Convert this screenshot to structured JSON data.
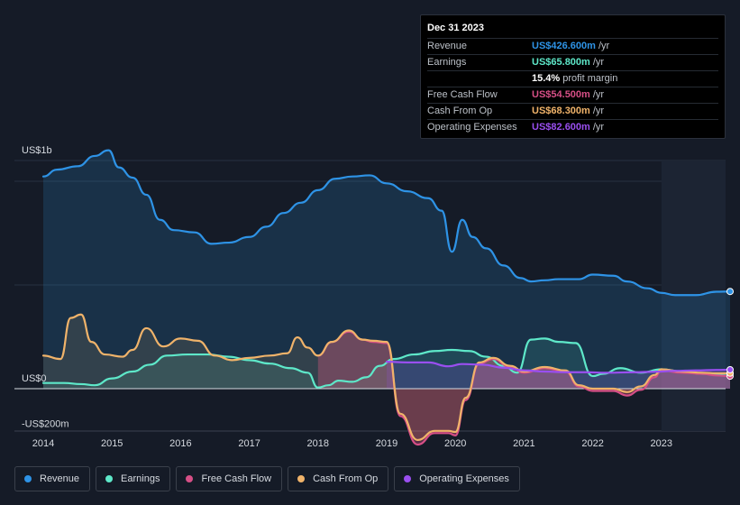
{
  "tooltip": {
    "date": "Dec 31 2023",
    "rows": [
      {
        "label": "Revenue",
        "value": "US$426.600m",
        "unit": "/yr",
        "color": "#2e93e6"
      },
      {
        "label": "Earnings",
        "value": "US$65.800m",
        "unit": "/yr",
        "color": "#5ee8c9"
      },
      {
        "label": "",
        "value": "15.4%",
        "unit": "profit margin",
        "color": "#ffffff"
      },
      {
        "label": "Free Cash Flow",
        "value": "US$54.500m",
        "unit": "/yr",
        "color": "#d64f86"
      },
      {
        "label": "Cash From Op",
        "value": "US$68.300m",
        "unit": "/yr",
        "color": "#f0b36a"
      },
      {
        "label": "Operating Expenses",
        "value": "US$82.600m",
        "unit": "/yr",
        "color": "#9a4ff0"
      }
    ]
  },
  "chart_data": {
    "type": "area",
    "y_tick_labels": [
      "US$1b",
      "US$0",
      "-US$200m"
    ],
    "ylim": [
      -200,
      1000
    ],
    "xlim": [
      2013.6,
      2024.0
    ],
    "x_tick_labels": [
      "2014",
      "2015",
      "2016",
      "2017",
      "2018",
      "2019",
      "2020",
      "2021",
      "2022",
      "2023"
    ],
    "x_ticks": [
      2014,
      2015,
      2016,
      2017,
      2018,
      2019,
      2020,
      2021,
      2022,
      2023
    ],
    "highlight_from": 2023.0,
    "grid": true,
    "series": [
      {
        "name": "Revenue",
        "color": "#2e93e6",
        "x": [
          2014.0,
          2014.2,
          2014.5,
          2014.75,
          2014.95,
          2015.1,
          2015.3,
          2015.5,
          2015.7,
          2015.9,
          2016.2,
          2016.45,
          2016.7,
          2017.0,
          2017.25,
          2017.5,
          2017.75,
          2018.0,
          2018.25,
          2018.5,
          2018.75,
          2019.0,
          2019.3,
          2019.6,
          2019.8,
          2019.95,
          2020.1,
          2020.25,
          2020.45,
          2020.7,
          2020.95,
          2021.1,
          2021.3,
          2021.5,
          2021.8,
          2022.0,
          2022.3,
          2022.5,
          2022.8,
          2023.0,
          2023.2,
          2023.5,
          2023.8,
          2024.0
        ],
        "y": [
          930,
          960,
          975,
          1020,
          1045,
          970,
          925,
          850,
          740,
          695,
          685,
          635,
          640,
          665,
          710,
          770,
          815,
          870,
          920,
          930,
          935,
          900,
          865,
          835,
          780,
          600,
          740,
          665,
          615,
          540,
          485,
          470,
          475,
          480,
          480,
          500,
          495,
          470,
          440,
          420,
          410,
          410,
          425,
          426
        ]
      },
      {
        "name": "Earnings",
        "color": "#5ee8c9",
        "x": [
          2014.0,
          2014.3,
          2014.55,
          2014.75,
          2015.0,
          2015.3,
          2015.55,
          2015.8,
          2016.1,
          2016.4,
          2016.7,
          2017.0,
          2017.3,
          2017.6,
          2017.85,
          2018.0,
          2018.15,
          2018.3,
          2018.5,
          2018.7,
          2018.9,
          2019.1,
          2019.4,
          2019.7,
          2019.95,
          2020.2,
          2020.45,
          2020.7,
          2020.9,
          2021.1,
          2021.3,
          2021.5,
          2021.75,
          2022.0,
          2022.15,
          2022.4,
          2022.7,
          2023.0,
          2023.3,
          2023.6,
          2023.8,
          2024.0
        ],
        "y": [
          25,
          25,
          20,
          15,
          45,
          75,
          105,
          145,
          150,
          150,
          140,
          125,
          110,
          90,
          70,
          5,
          15,
          35,
          30,
          50,
          100,
          130,
          150,
          165,
          170,
          165,
          140,
          100,
          70,
          215,
          220,
          205,
          200,
          55,
          65,
          90,
          70,
          85,
          75,
          65,
          65,
          66
        ]
      },
      {
        "name": "Free Cash Flow",
        "color": "#d64f86",
        "x": [
          2018.0,
          2018.2,
          2018.45,
          2018.65,
          2018.8,
          2019.0,
          2019.2,
          2019.45,
          2019.7,
          2019.9,
          2020.0,
          2020.15,
          2020.35,
          2020.55,
          2020.8,
          2021.0,
          2021.3,
          2021.6,
          2021.8,
          2022.0,
          2022.3,
          2022.5,
          2022.7,
          2022.9,
          2023.0,
          2023.3,
          2023.6,
          2023.8,
          2024.0
        ],
        "y": [
          145,
          205,
          250,
          215,
          205,
          200,
          -120,
          -245,
          -195,
          -195,
          -205,
          -50,
          110,
          130,
          95,
          70,
          90,
          75,
          10,
          -10,
          -10,
          -30,
          -5,
          50,
          80,
          70,
          65,
          58,
          55
        ]
      },
      {
        "name": "Cash From Op",
        "color": "#f0b36a",
        "x": [
          2014.0,
          2014.25,
          2014.4,
          2014.55,
          2014.7,
          2014.9,
          2015.15,
          2015.3,
          2015.5,
          2015.75,
          2016.0,
          2016.25,
          2016.5,
          2016.75,
          2017.0,
          2017.3,
          2017.55,
          2017.7,
          2017.85,
          2018.0,
          2018.2,
          2018.45,
          2018.65,
          2018.8,
          2019.0,
          2019.2,
          2019.45,
          2019.7,
          2019.9,
          2020.0,
          2020.15,
          2020.35,
          2020.55,
          2020.8,
          2021.0,
          2021.3,
          2021.6,
          2021.8,
          2022.0,
          2022.3,
          2022.5,
          2022.7,
          2022.9,
          2023.0,
          2023.3,
          2023.6,
          2023.8,
          2024.0
        ],
        "y": [
          145,
          130,
          310,
          325,
          205,
          150,
          140,
          170,
          265,
          185,
          220,
          210,
          145,
          125,
          135,
          145,
          155,
          225,
          180,
          145,
          205,
          255,
          215,
          210,
          205,
          -110,
          -225,
          -185,
          -185,
          -190,
          -40,
          115,
          135,
          100,
          75,
          95,
          80,
          15,
          0,
          0,
          -15,
          10,
          60,
          85,
          75,
          70,
          68,
          68
        ]
      },
      {
        "name": "Operating Expenses",
        "color": "#9a4ff0",
        "x": [
          2019.0,
          2019.3,
          2019.6,
          2019.9,
          2020.1,
          2020.4,
          2020.7,
          2021.0,
          2021.3,
          2021.6,
          2021.9,
          2022.2,
          2022.6,
          2022.9,
          2023.2,
          2023.5,
          2023.8,
          2024.0
        ],
        "y": [
          118,
          115,
          115,
          98,
          108,
          105,
          92,
          80,
          75,
          72,
          72,
          70,
          72,
          74,
          78,
          80,
          82,
          83
        ]
      }
    ]
  },
  "legend": [
    {
      "label": "Revenue",
      "color": "#2e93e6"
    },
    {
      "label": "Earnings",
      "color": "#5ee8c9"
    },
    {
      "label": "Free Cash Flow",
      "color": "#d64f86"
    },
    {
      "label": "Cash From Op",
      "color": "#f0b36a"
    },
    {
      "label": "Operating Expenses",
      "color": "#9a4ff0"
    }
  ]
}
